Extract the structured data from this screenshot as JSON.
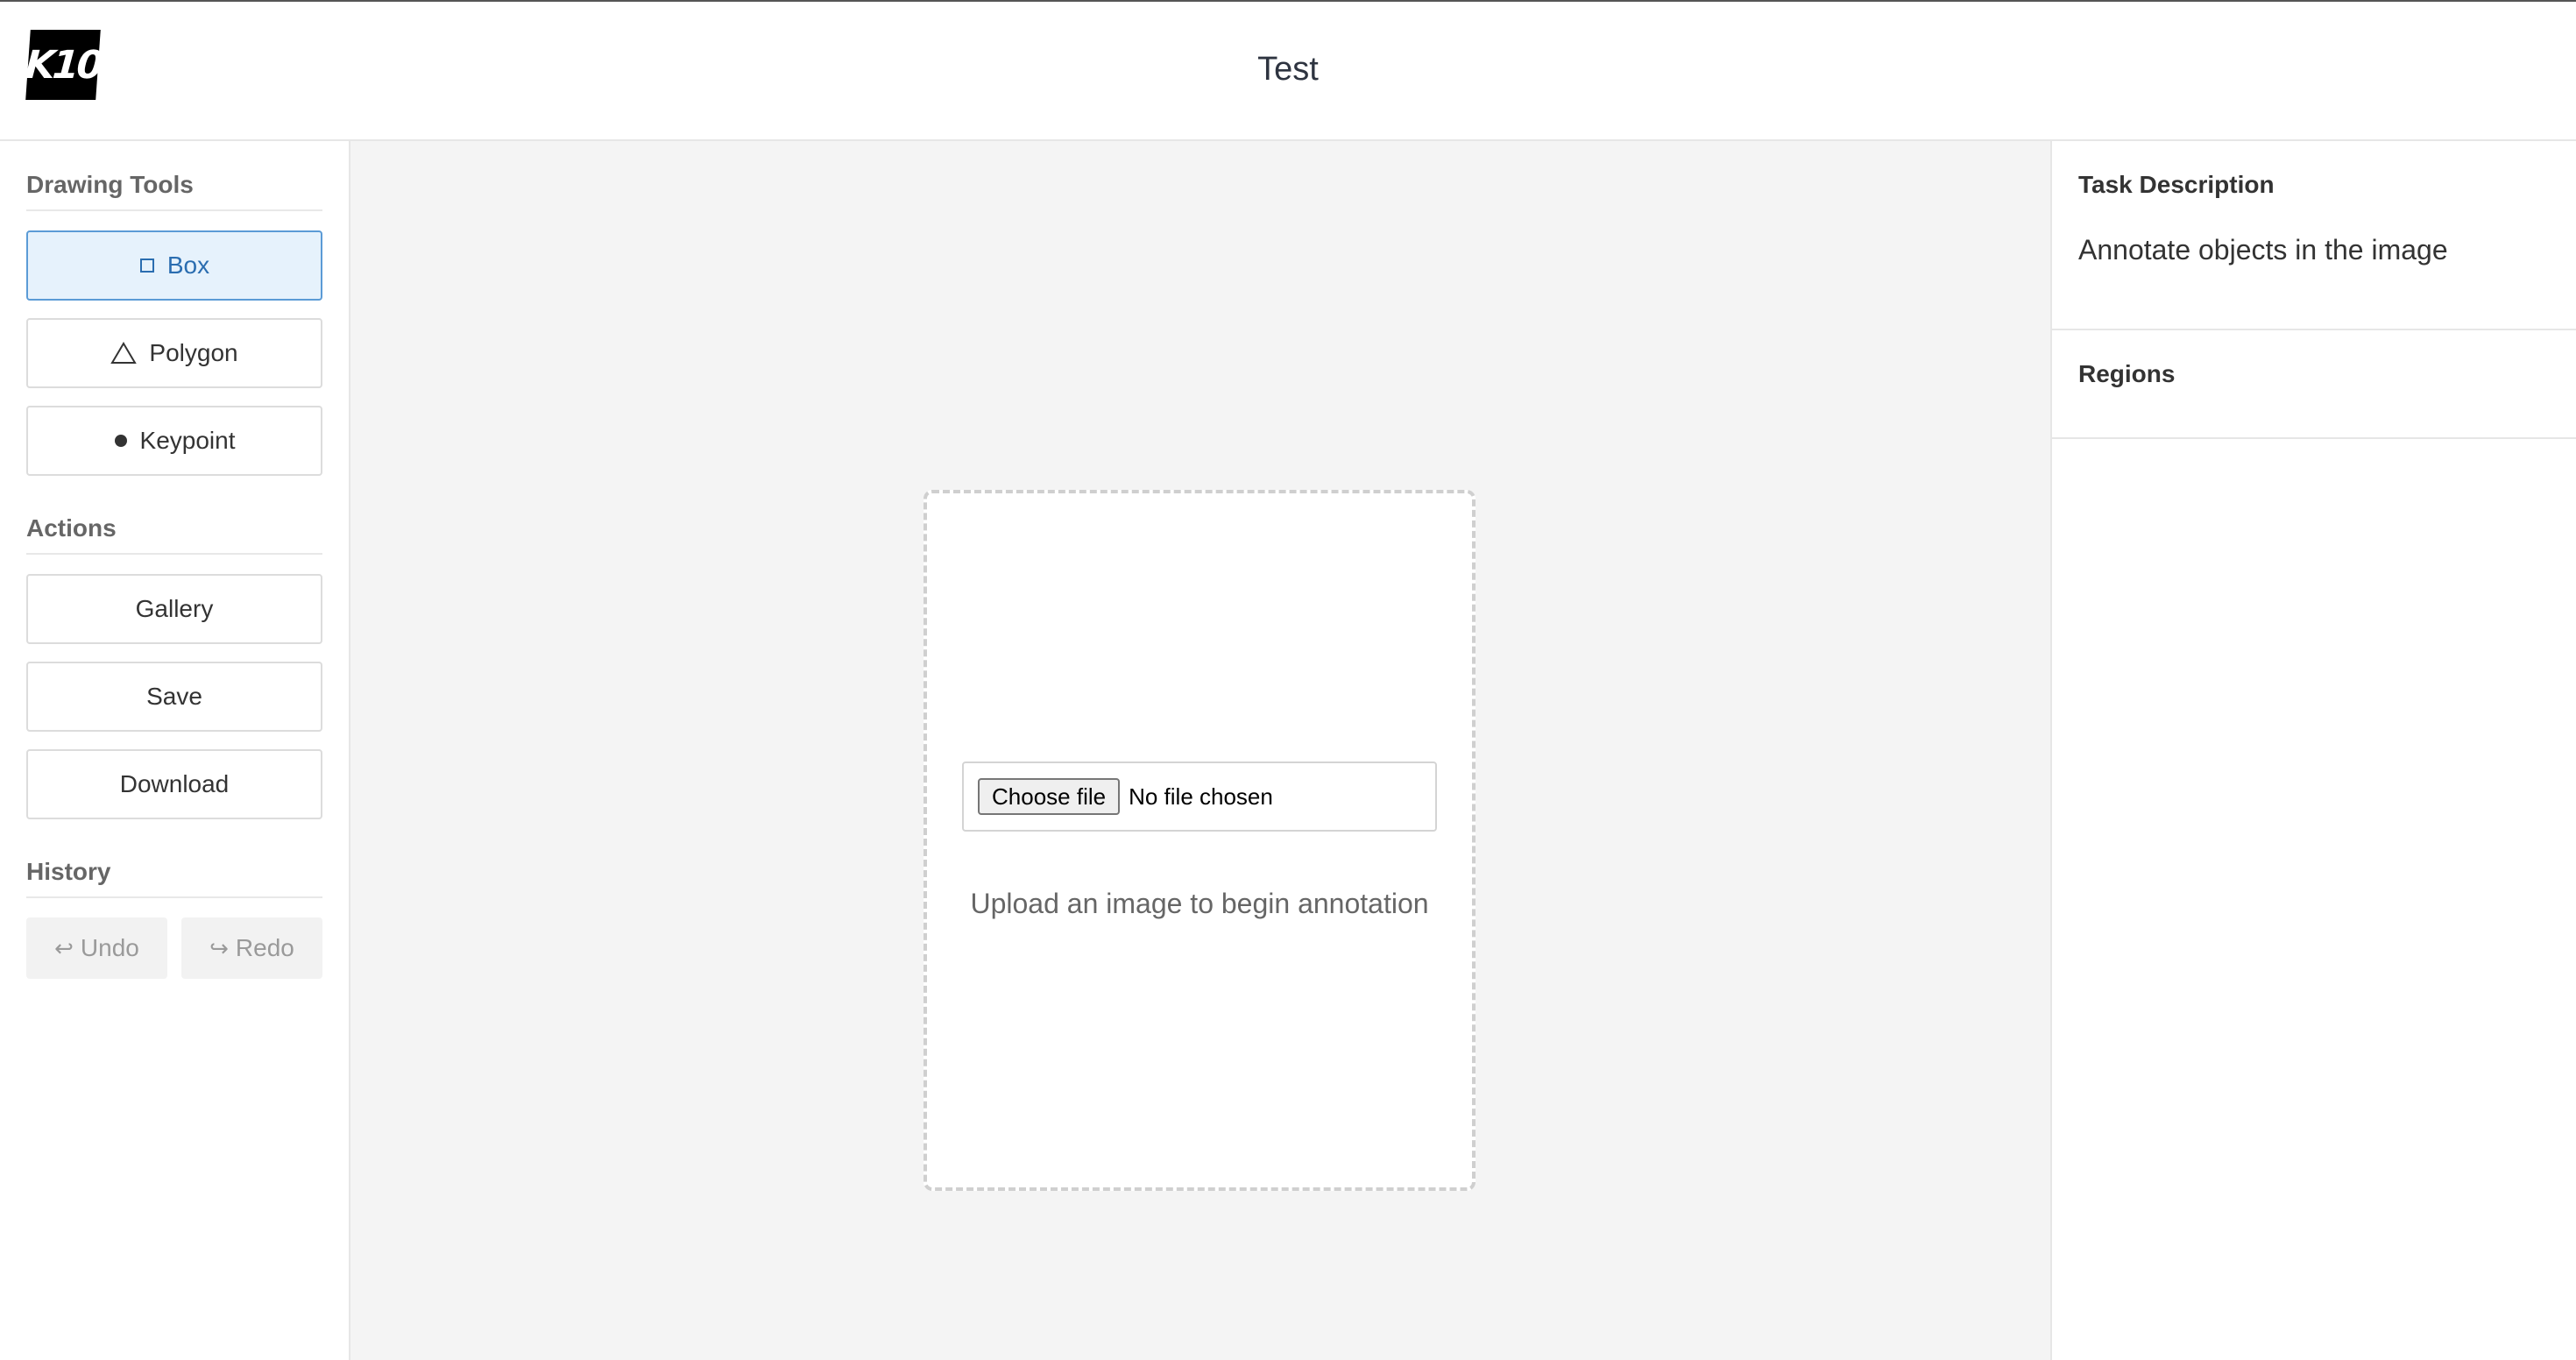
{
  "header": {
    "logo_text": "K10",
    "title": "Test"
  },
  "sidebar": {
    "drawing_tools": {
      "title": "Drawing Tools",
      "items": [
        {
          "label": "Box",
          "icon": "square-icon",
          "active": true
        },
        {
          "label": "Polygon",
          "icon": "triangle-icon",
          "active": false
        },
        {
          "label": "Keypoint",
          "icon": "dot-icon",
          "active": false
        }
      ]
    },
    "actions": {
      "title": "Actions",
      "items": [
        {
          "label": "Gallery"
        },
        {
          "label": "Save"
        },
        {
          "label": "Download"
        }
      ]
    },
    "history": {
      "title": "History",
      "undo_label": "Undo",
      "redo_label": "Redo"
    }
  },
  "canvas": {
    "choose_file_label": "Choose file",
    "no_file_text": "No file chosen",
    "upload_hint": "Upload an image to begin annotation"
  },
  "right_panel": {
    "task_title": "Task Description",
    "task_text": "Annotate objects in the image",
    "regions_title": "Regions"
  },
  "colors": {
    "accent": "#5b9bd6",
    "active_bg": "#e6f2fc",
    "canvas_bg": "#f4f4f4"
  }
}
